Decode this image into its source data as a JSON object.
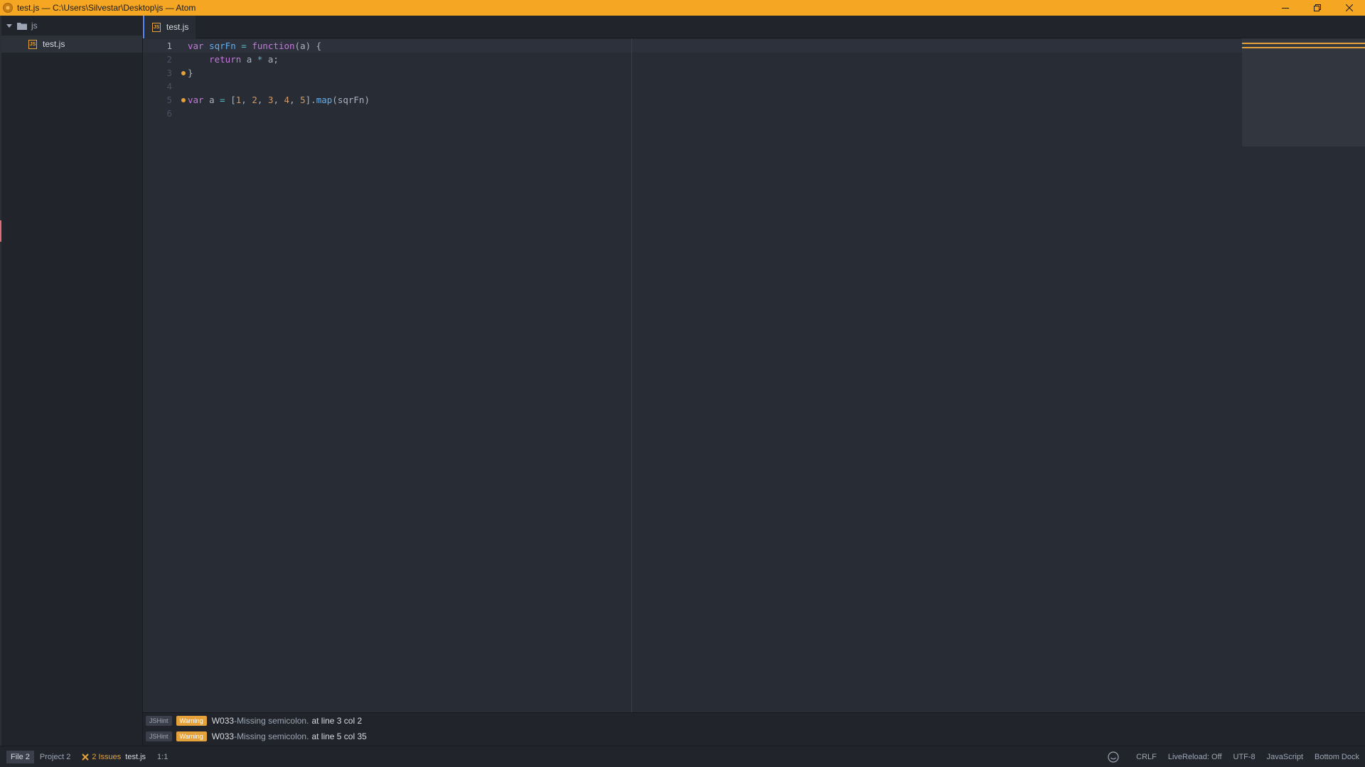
{
  "window": {
    "title": "test.js — C:\\Users\\Silvestar\\Desktop\\js — Atom"
  },
  "tree": {
    "root_label": "js",
    "files": [
      {
        "label": "test.js",
        "icon_text": "JS"
      }
    ]
  },
  "tabs": [
    {
      "label": "test.js",
      "icon_text": "JS"
    }
  ],
  "editor": {
    "line_numbers": [
      "1",
      "2",
      "3",
      "4",
      "5",
      "6"
    ],
    "lines": [
      [
        {
          "t": "var ",
          "c": "kw"
        },
        {
          "t": "sqrFn",
          "c": "fn"
        },
        {
          "t": " = ",
          "c": "op"
        },
        {
          "t": "function",
          "c": "kw"
        },
        {
          "t": "(a) {",
          "c": "plain"
        }
      ],
      [
        {
          "t": "    ",
          "c": "plain"
        },
        {
          "t": "return",
          "c": "kw"
        },
        {
          "t": " a ",
          "c": "plain"
        },
        {
          "t": "*",
          "c": "op"
        },
        {
          "t": " a;",
          "c": "plain"
        }
      ],
      [
        {
          "t": "}",
          "c": "plain"
        }
      ],
      [],
      [
        {
          "t": "var",
          "c": "kw"
        },
        {
          "t": " a ",
          "c": "plain"
        },
        {
          "t": "=",
          "c": "op"
        },
        {
          "t": " [",
          "c": "plain"
        },
        {
          "t": "1",
          "c": "num"
        },
        {
          "t": ", ",
          "c": "plain"
        },
        {
          "t": "2",
          "c": "num"
        },
        {
          "t": ", ",
          "c": "plain"
        },
        {
          "t": "3",
          "c": "num"
        },
        {
          "t": ", ",
          "c": "plain"
        },
        {
          "t": "4",
          "c": "num"
        },
        {
          "t": ", ",
          "c": "plain"
        },
        {
          "t": "5",
          "c": "num"
        },
        {
          "t": "].",
          "c": "plain"
        },
        {
          "t": "map",
          "c": "fn"
        },
        {
          "t": "(sqrFn)",
          "c": "plain"
        }
      ],
      []
    ],
    "lint_marker_lines": [
      3,
      5
    ]
  },
  "linter": {
    "messages": [
      {
        "source": "JSHint",
        "severity": "Warning",
        "code": "W033",
        "separator": " - ",
        "text": "Missing semicolon.",
        "location": "at line 3 col 2"
      },
      {
        "source": "JSHint",
        "severity": "Warning",
        "code": "W033",
        "separator": " - ",
        "text": "Missing semicolon.",
        "location": "at line 5 col 35"
      }
    ]
  },
  "status": {
    "file_tab": "File 2",
    "project_tab": "Project 2",
    "issues": "2 Issues",
    "file_name": "test.js",
    "cursor": "1:1",
    "line_ending": "CRLF",
    "live_reload": "LiveReload: Off",
    "encoding": "UTF-8",
    "grammar": "JavaScript",
    "dock": "Bottom Dock"
  },
  "colors": {
    "title_bar": "#f5a623",
    "editor_bg": "#282c34",
    "warning": "#e5a23a",
    "accent": "#568af2"
  }
}
